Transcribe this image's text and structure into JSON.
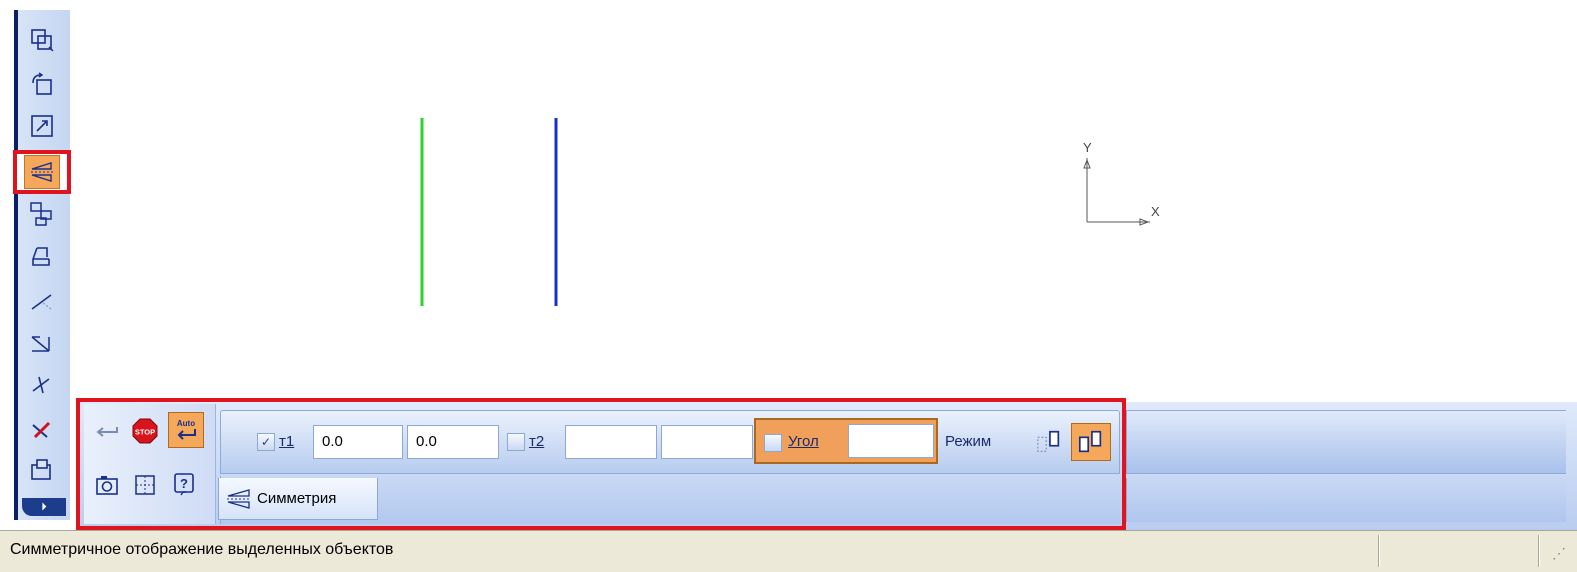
{
  "toolbar": {
    "icons": [
      "shift-icon",
      "rotate-icon",
      "scale-icon",
      "symmetry-icon",
      "copy-icon",
      "deform-icon",
      "trim-icon",
      "trim-by-two-points-icon",
      "break-icon",
      "delete-icon",
      "clear-area-icon"
    ],
    "active_index": 3,
    "more_label": "⏵"
  },
  "canvas": {
    "lines": [
      {
        "color": "#2ed12e"
      },
      {
        "color": "#1a2fc8"
      }
    ],
    "axis_y_label": "Y",
    "axis_x_label": "X"
  },
  "panel": {
    "controls": [
      "enter-icon",
      "stop-icon",
      "auto-create-icon",
      "snapshot-icon",
      "fit-icon",
      "help-icon"
    ],
    "t1_label": "т1",
    "t1_x": "0.0",
    "t1_y": "0.0",
    "t1_checked": true,
    "t2_label": "т2",
    "t2_x": "",
    "t2_y": "",
    "t2_checked": false,
    "angle_label": "Угол",
    "angle_value": "",
    "mode_label": "Режим",
    "tab_label": "Симметрия"
  },
  "status": {
    "message": "Симметричное отображение выделенных объектов"
  },
  "colors": {
    "highlight_frame": "#e0141e",
    "active_fill": "#f6a85a"
  }
}
